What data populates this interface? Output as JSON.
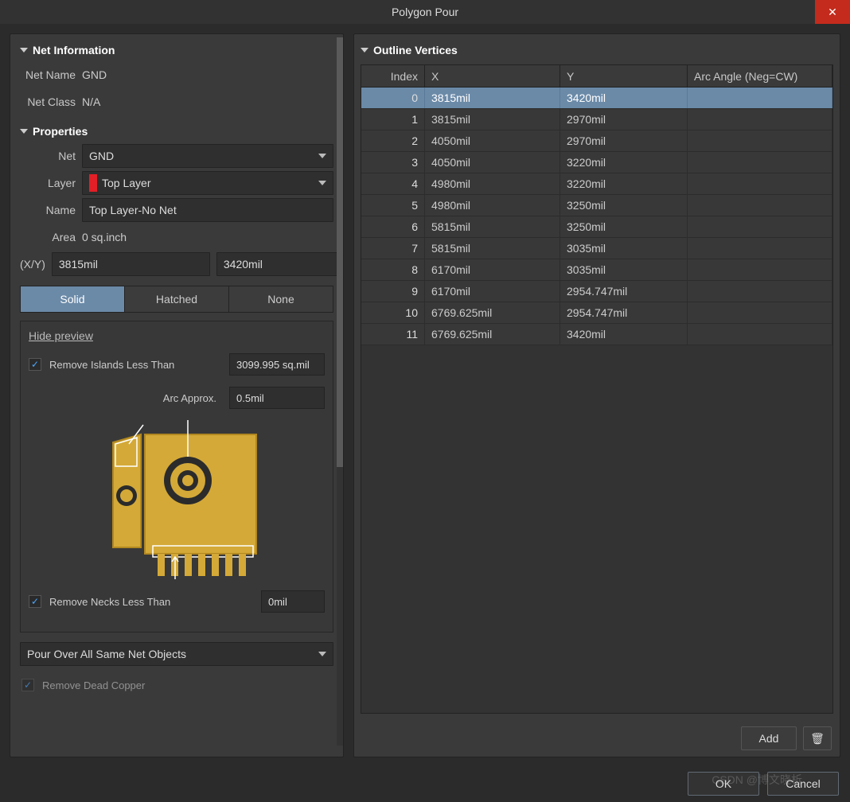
{
  "title": "Polygon Pour",
  "sections": {
    "netinfo": {
      "header": "Net Information",
      "netname_label": "Net Name",
      "netname_value": "GND",
      "netclass_label": "Net Class",
      "netclass_value": "N/A"
    },
    "properties": {
      "header": "Properties",
      "net_label": "Net",
      "net_value": "GND",
      "layer_label": "Layer",
      "layer_value": "Top Layer",
      "layer_swatch": "#e21f26",
      "name_label": "Name",
      "name_value": "Top Layer-No Net",
      "area_label": "Area",
      "area_value": "0 sq.inch",
      "xy_label": "(X/Y)",
      "x_value": "3815mil",
      "y_value": "3420mil",
      "fill_modes": {
        "solid": "Solid",
        "hatched": "Hatched",
        "none": "None"
      },
      "hide_preview": "Hide preview",
      "remove_islands_label": "Remove Islands Less Than",
      "remove_islands_value": "3099.995 sq.mil",
      "arc_approx_label": "Arc Approx.",
      "arc_approx_value": "0.5mil",
      "remove_necks_label": "Remove Necks Less Than",
      "remove_necks_value": "0mil",
      "pour_mode": "Pour Over All Same Net Objects",
      "remove_dead_copper": "Remove Dead Copper"
    },
    "vertices": {
      "header": "Outline Vertices",
      "columns": {
        "index": "Index",
        "x": "X",
        "y": "Y",
        "arc": "Arc Angle (Neg=CW)"
      },
      "rows": [
        {
          "index": "0",
          "x": "3815mil",
          "y": "3420mil",
          "arc": ""
        },
        {
          "index": "1",
          "x": "3815mil",
          "y": "2970mil",
          "arc": ""
        },
        {
          "index": "2",
          "x": "4050mil",
          "y": "2970mil",
          "arc": ""
        },
        {
          "index": "3",
          "x": "4050mil",
          "y": "3220mil",
          "arc": ""
        },
        {
          "index": "4",
          "x": "4980mil",
          "y": "3220mil",
          "arc": ""
        },
        {
          "index": "5",
          "x": "4980mil",
          "y": "3250mil",
          "arc": ""
        },
        {
          "index": "6",
          "x": "5815mil",
          "y": "3250mil",
          "arc": ""
        },
        {
          "index": "7",
          "x": "5815mil",
          "y": "3035mil",
          "arc": ""
        },
        {
          "index": "8",
          "x": "6170mil",
          "y": "3035mil",
          "arc": ""
        },
        {
          "index": "9",
          "x": "6170mil",
          "y": "2954.747mil",
          "arc": ""
        },
        {
          "index": "10",
          "x": "6769.625mil",
          "y": "2954.747mil",
          "arc": ""
        },
        {
          "index": "11",
          "x": "6769.625mil",
          "y": "3420mil",
          "arc": ""
        }
      ],
      "selected_index": 0,
      "add_label": "Add"
    }
  },
  "footer": {
    "ok": "OK",
    "cancel": "Cancel"
  },
  "watermark": "CSDN @博文晓析"
}
